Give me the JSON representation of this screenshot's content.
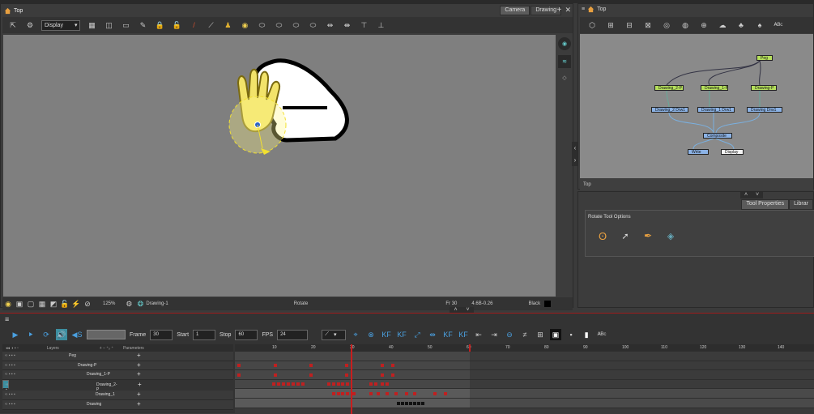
{
  "camera_view": {
    "title": "Top",
    "tabs": [
      "Camera",
      "Drawing"
    ],
    "display_select": "Display",
    "status": {
      "zoom": "125%",
      "drawing": "Drawing-1",
      "tool": "Rotate",
      "frame": "Fr 30",
      "coords": "4.6B-0.26",
      "color": "Black"
    }
  },
  "node_view": {
    "title": "Top",
    "footer": "Top",
    "nodes": [
      {
        "label": "Peg",
        "kind": "g"
      },
      {
        "label": "Drawing_2-P",
        "kind": "g"
      },
      {
        "label": "Drawing_1-P",
        "kind": "g"
      },
      {
        "label": "Drawing-P",
        "kind": "g"
      },
      {
        "label": "Drawing_2 Drw1",
        "kind": "b"
      },
      {
        "label": "Drawing_1 Drw1",
        "kind": "b"
      },
      {
        "label": "Drawing Drw1",
        "kind": "b"
      },
      {
        "label": "Composite",
        "kind": "b"
      },
      {
        "label": "Write",
        "kind": "b"
      },
      {
        "label": "Display",
        "kind": "w"
      }
    ]
  },
  "tool_properties": {
    "tabs": [
      "Tool Properties",
      "Librar"
    ],
    "options_title": "Rotate Tool Options"
  },
  "timeline": {
    "frame_label": "Frame",
    "frame_value": "30",
    "start_label": "Start",
    "start_value": "1",
    "stop_label": "Stop",
    "stop_value": "60",
    "fps_label": "FPS",
    "fps_value": "24",
    "layers_header": "Layers",
    "parameters_header": "Parameters",
    "ruler_marks": [
      "10",
      "20",
      "30",
      "40",
      "50",
      "60",
      "70",
      "80",
      "90",
      "100",
      "110",
      "120",
      "130",
      "140"
    ],
    "layers": [
      {
        "name": "Peg",
        "indent": 0
      },
      {
        "name": "Drawing-P",
        "indent": 1
      },
      {
        "name": "Drawing_1-P",
        "indent": 2
      },
      {
        "name": "Drawing_2-P",
        "indent": 3
      },
      {
        "name": "Drawing_1",
        "indent": 3
      },
      {
        "name": "Drawing",
        "indent": 2
      }
    ]
  }
}
